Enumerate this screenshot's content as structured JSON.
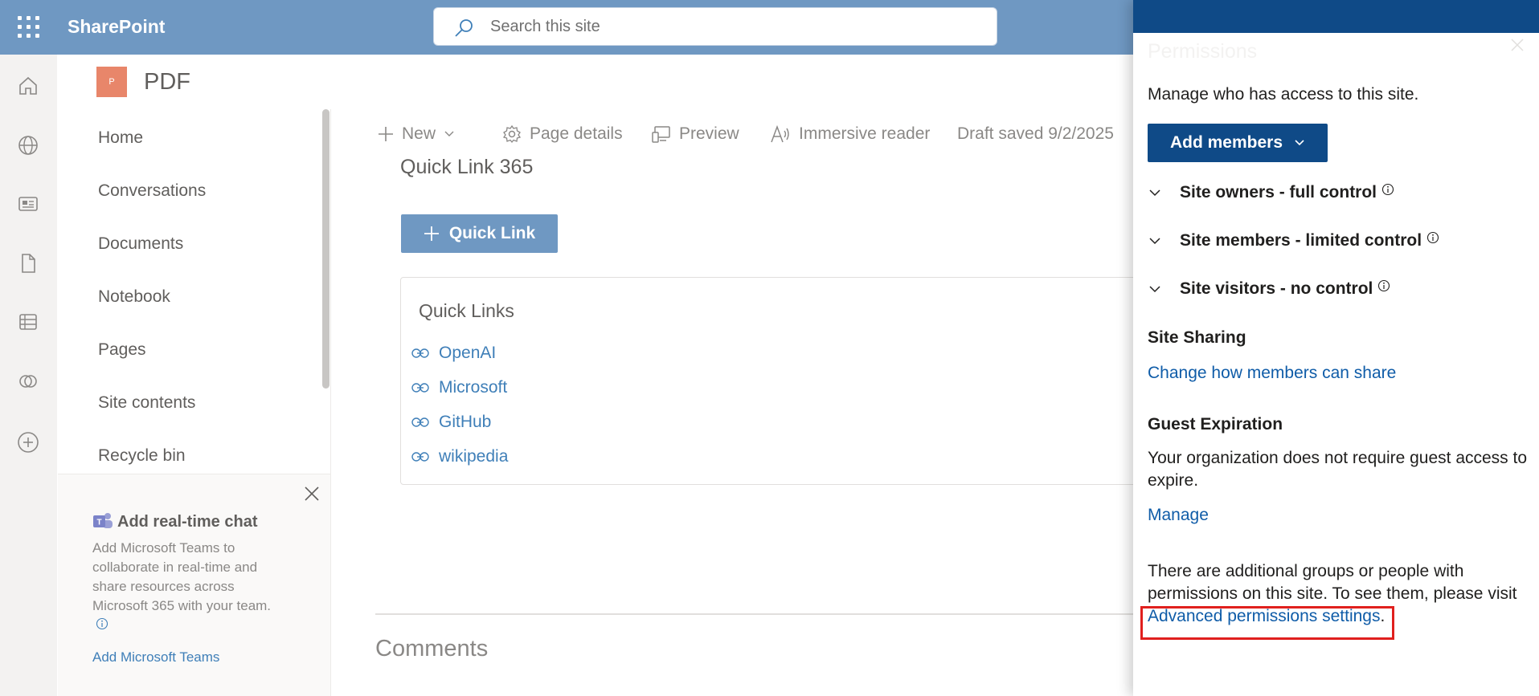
{
  "suite_bar": {
    "app_name": "SharePoint",
    "search_placeholder": "Search this site"
  },
  "site": {
    "logo_letter": "P",
    "title": "PDF"
  },
  "left_nav": {
    "items": [
      {
        "label": "Home"
      },
      {
        "label": "Conversations"
      },
      {
        "label": "Documents"
      },
      {
        "label": "Notebook"
      },
      {
        "label": "Pages"
      },
      {
        "label": "Site contents"
      },
      {
        "label": "Recycle bin"
      }
    ]
  },
  "teams_card": {
    "title": "Add real-time chat",
    "description": "Add Microsoft Teams to collaborate in real-time and share resources across Microsoft 365 with your team.",
    "link": "Add Microsoft Teams"
  },
  "command_bar": {
    "new": "New",
    "page_details": "Page details",
    "preview": "Preview",
    "immersive_reader": "Immersive reader",
    "draft_status": "Draft saved 9/2/2025"
  },
  "content": {
    "webpart_title": "Quick Link 365",
    "add_quick_link": "Quick Link",
    "quick_links_heading": "Quick Links",
    "links": [
      {
        "label": "OpenAI"
      },
      {
        "label": "Microsoft"
      },
      {
        "label": "GitHub"
      },
      {
        "label": "wikipedia"
      }
    ],
    "comments_heading": "Comments"
  },
  "permissions_panel": {
    "title": "Permissions",
    "intro": "Manage who has access to this site.",
    "add_members": "Add members",
    "groups": [
      {
        "label": "Site owners - full control"
      },
      {
        "label": "Site members - limited control"
      },
      {
        "label": "Site visitors - no control"
      }
    ],
    "site_sharing_heading": "Site Sharing",
    "site_sharing_link": "Change how members can share",
    "guest_expiration_heading": "Guest Expiration",
    "guest_expiration_text": "Your organization does not require guest access to expire.",
    "manage_link": "Manage",
    "additional_text": "There are additional groups or people with permissions on this site. To see them, please visit",
    "advanced_link": "Advanced permissions settings",
    "period": "."
  },
  "colors": {
    "suite_bar": "#6f98c2",
    "panel_accent": "#0f4a87",
    "link": "#0f5ca8",
    "highlight": "#e0201e"
  }
}
